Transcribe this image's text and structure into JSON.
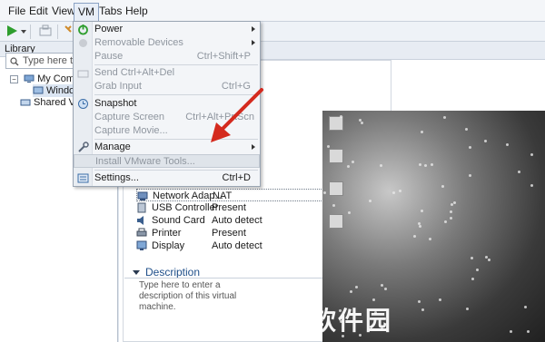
{
  "menubar": {
    "items": [
      {
        "label": "File"
      },
      {
        "label": "Edit"
      },
      {
        "label": "View"
      },
      {
        "label": "VM"
      },
      {
        "label": "Tabs"
      },
      {
        "label": "Help"
      }
    ]
  },
  "library": {
    "title": "Library",
    "search_placeholder": "Type here to s",
    "tree": [
      {
        "label": "My Comput"
      },
      {
        "label": "Window"
      },
      {
        "label": "Shared VMs"
      }
    ]
  },
  "vm_menu": {
    "items": [
      {
        "label": "Power",
        "shortcut": "",
        "submenu": true,
        "disabled": false
      },
      {
        "label": "Removable Devices",
        "shortcut": "",
        "submenu": true,
        "disabled": true
      },
      {
        "label": "Pause",
        "shortcut": "Ctrl+Shift+P",
        "submenu": false,
        "disabled": true
      },
      {
        "label": "Send Ctrl+Alt+Del",
        "shortcut": "",
        "submenu": false,
        "disabled": true
      },
      {
        "label": "Grab Input",
        "shortcut": "Ctrl+G",
        "submenu": false,
        "disabled": true
      },
      {
        "label": "Snapshot",
        "shortcut": "",
        "submenu": false,
        "disabled": false
      },
      {
        "label": "Capture Screen",
        "shortcut": "Ctrl+Alt+PrtScn",
        "submenu": false,
        "disabled": true
      },
      {
        "label": "Capture Movie...",
        "shortcut": "",
        "submenu": false,
        "disabled": true
      },
      {
        "label": "Manage",
        "shortcut": "",
        "submenu": true,
        "disabled": false
      },
      {
        "label": "Install VMware Tools...",
        "shortcut": "",
        "submenu": false,
        "disabled": true
      },
      {
        "label": "Settings...",
        "shortcut": "Ctrl+D",
        "submenu": false,
        "disabled": false
      }
    ]
  },
  "devices": [
    {
      "name": "Network Adap...",
      "value": "NAT"
    },
    {
      "name": "USB Controller",
      "value": "Present"
    },
    {
      "name": "Sound Card",
      "value": "Auto detect"
    },
    {
      "name": "Printer",
      "value": "Present"
    },
    {
      "name": "Display",
      "value": "Auto detect"
    }
  ],
  "description": {
    "title": "Description",
    "placeholder": "Type here to enter a description of this virtual machine."
  },
  "watermark": "人人软件园",
  "colors": {
    "accent": "#1f4f8a",
    "arrow": "#d42a1e",
    "power_green": "#2e9e2e"
  }
}
